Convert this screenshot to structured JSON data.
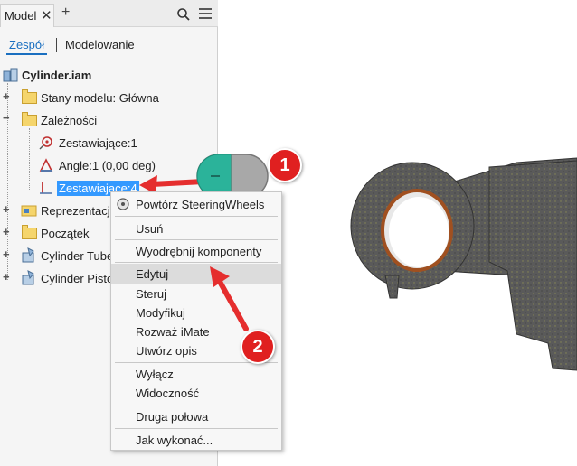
{
  "panel": {
    "tab_label": "Model",
    "subtabs": {
      "assembly": "Zespół",
      "modeling": "Modelowanie"
    }
  },
  "tree": {
    "root": "Cylinder.iam",
    "items": [
      "Stany modelu: Główna",
      "Zależności",
      "Zestawiające:1",
      "Angle:1 (0,00 deg)",
      "Zestawiające:4",
      "Reprezentacje",
      "Początek",
      "Cylinder Tube",
      "Cylinder Piston"
    ]
  },
  "context_menu": {
    "items": [
      "Powtórz SteeringWheels",
      "Usuń",
      "Wyodrębnij komponenty",
      "Edytuj",
      "Steruj",
      "Modyfikuj",
      "Rozważ iMate",
      "Utwórz opis",
      "Wyłącz",
      "Widoczność",
      "Druga połowa",
      "Jak wykonać..."
    ]
  },
  "annotations": {
    "step1": "1",
    "step2": "2"
  },
  "colors": {
    "selection": "#3399ff",
    "accent": "#1a6fc0",
    "badge": "#e02020",
    "mouse_button": "#2bb39a"
  },
  "icons": [
    "close-icon",
    "add-tab-icon",
    "search-icon",
    "menu-icon",
    "assembly-icon",
    "folder-icon",
    "constraint-icon",
    "steeringwheels-icon",
    "mouse-icon"
  ]
}
